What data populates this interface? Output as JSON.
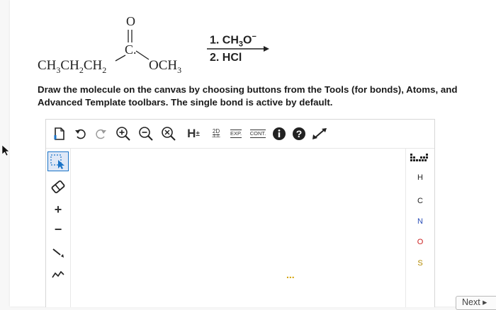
{
  "scheme": {
    "carbonyl_oxygen": "O",
    "carbonyl_carbon": "C.",
    "reactant_left": "CH3CH2CH2",
    "reactant_right": "OCH3",
    "reagent_step1": "1. CH3O",
    "reagent_step2": "2. HCl"
  },
  "instructions": "Draw the molecule on the canvas by choosing buttons from the Tools (for bonds), Atoms, and Advanced Template toolbars. The single bond is active by default.",
  "toolbar": {
    "h_label": "H",
    "h_sup": "±",
    "twod_label": "2D",
    "exp_label": "EXP.",
    "cont_label": "CONT."
  },
  "atoms": [
    "H",
    "C",
    "N",
    "O",
    "S"
  ],
  "canvas_marker": "...",
  "next_label": "Next ▸",
  "colors": {
    "accent_blue": "#1a73c7",
    "atom_N": "#2d4fb8",
    "atom_O": "#cc2222",
    "atom_S": "#b38a00",
    "dark_icon": "#222222"
  }
}
